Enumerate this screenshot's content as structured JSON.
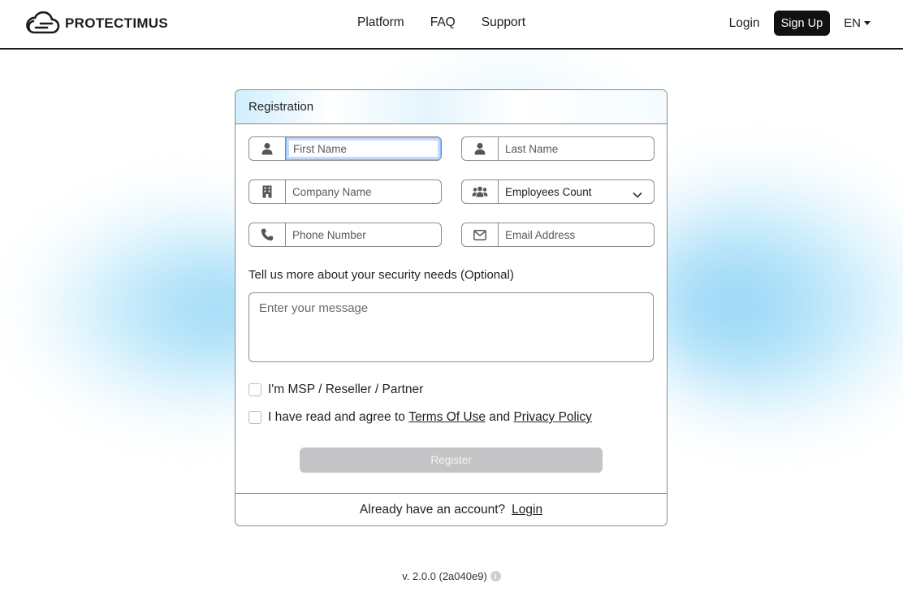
{
  "brand": {
    "name": "PROTECTIMUS"
  },
  "nav": {
    "items": [
      {
        "label": "Platform"
      },
      {
        "label": "FAQ"
      },
      {
        "label": "Support"
      }
    ],
    "login_label": "Login",
    "signup_label": "Sign Up",
    "language": "EN"
  },
  "form": {
    "title": "Registration",
    "fields": {
      "first_name": {
        "placeholder": "First Name",
        "icon": "user-icon"
      },
      "last_name": {
        "placeholder": "Last Name",
        "icon": "user-icon"
      },
      "company": {
        "placeholder": "Company Name",
        "icon": "building-icon"
      },
      "employees": {
        "value": "Employees Count",
        "icon": "users-icon"
      },
      "phone": {
        "placeholder": "Phone Number",
        "icon": "phone-icon"
      },
      "email": {
        "placeholder": "Email Address",
        "icon": "envelope-icon"
      }
    },
    "message_label": "Tell us more about your security needs (Optional)",
    "message_placeholder": "Enter your message",
    "msp_label": "I'm MSP / Reseller / Partner",
    "agree": {
      "prefix": "I have read and agree to",
      "terms": "Terms Of Use",
      "and": "and",
      "privacy": "Privacy Policy"
    },
    "register_label": "Register",
    "footer_text": "Already have an account?",
    "footer_login": "Login"
  },
  "version": "v. 2.0.0 (2a040e9)",
  "colors": {
    "accent": "#111111",
    "disabled_button": "#c4c4c6",
    "glow": "#8fd3f6"
  }
}
